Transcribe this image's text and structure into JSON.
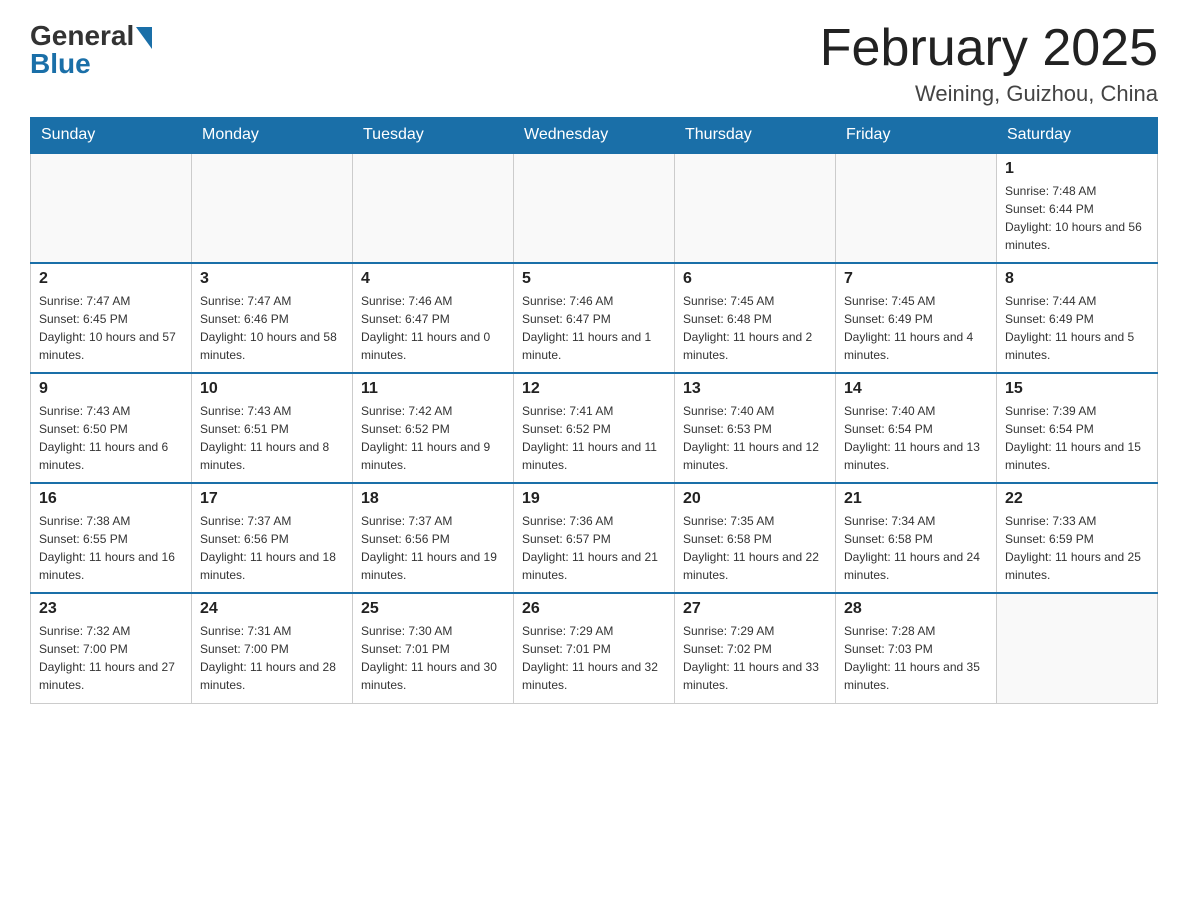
{
  "header": {
    "logo_general": "General",
    "logo_blue": "Blue",
    "month_title": "February 2025",
    "location": "Weining, Guizhou, China"
  },
  "weekdays": [
    "Sunday",
    "Monday",
    "Tuesday",
    "Wednesday",
    "Thursday",
    "Friday",
    "Saturday"
  ],
  "weeks": [
    [
      {
        "day": "",
        "sunrise": "",
        "sunset": "",
        "daylight": ""
      },
      {
        "day": "",
        "sunrise": "",
        "sunset": "",
        "daylight": ""
      },
      {
        "day": "",
        "sunrise": "",
        "sunset": "",
        "daylight": ""
      },
      {
        "day": "",
        "sunrise": "",
        "sunset": "",
        "daylight": ""
      },
      {
        "day": "",
        "sunrise": "",
        "sunset": "",
        "daylight": ""
      },
      {
        "day": "",
        "sunrise": "",
        "sunset": "",
        "daylight": ""
      },
      {
        "day": "1",
        "sunrise": "Sunrise: 7:48 AM",
        "sunset": "Sunset: 6:44 PM",
        "daylight": "Daylight: 10 hours and 56 minutes."
      }
    ],
    [
      {
        "day": "2",
        "sunrise": "Sunrise: 7:47 AM",
        "sunset": "Sunset: 6:45 PM",
        "daylight": "Daylight: 10 hours and 57 minutes."
      },
      {
        "day": "3",
        "sunrise": "Sunrise: 7:47 AM",
        "sunset": "Sunset: 6:46 PM",
        "daylight": "Daylight: 10 hours and 58 minutes."
      },
      {
        "day": "4",
        "sunrise": "Sunrise: 7:46 AM",
        "sunset": "Sunset: 6:47 PM",
        "daylight": "Daylight: 11 hours and 0 minutes."
      },
      {
        "day": "5",
        "sunrise": "Sunrise: 7:46 AM",
        "sunset": "Sunset: 6:47 PM",
        "daylight": "Daylight: 11 hours and 1 minute."
      },
      {
        "day": "6",
        "sunrise": "Sunrise: 7:45 AM",
        "sunset": "Sunset: 6:48 PM",
        "daylight": "Daylight: 11 hours and 2 minutes."
      },
      {
        "day": "7",
        "sunrise": "Sunrise: 7:45 AM",
        "sunset": "Sunset: 6:49 PM",
        "daylight": "Daylight: 11 hours and 4 minutes."
      },
      {
        "day": "8",
        "sunrise": "Sunrise: 7:44 AM",
        "sunset": "Sunset: 6:49 PM",
        "daylight": "Daylight: 11 hours and 5 minutes."
      }
    ],
    [
      {
        "day": "9",
        "sunrise": "Sunrise: 7:43 AM",
        "sunset": "Sunset: 6:50 PM",
        "daylight": "Daylight: 11 hours and 6 minutes."
      },
      {
        "day": "10",
        "sunrise": "Sunrise: 7:43 AM",
        "sunset": "Sunset: 6:51 PM",
        "daylight": "Daylight: 11 hours and 8 minutes."
      },
      {
        "day": "11",
        "sunrise": "Sunrise: 7:42 AM",
        "sunset": "Sunset: 6:52 PM",
        "daylight": "Daylight: 11 hours and 9 minutes."
      },
      {
        "day": "12",
        "sunrise": "Sunrise: 7:41 AM",
        "sunset": "Sunset: 6:52 PM",
        "daylight": "Daylight: 11 hours and 11 minutes."
      },
      {
        "day": "13",
        "sunrise": "Sunrise: 7:40 AM",
        "sunset": "Sunset: 6:53 PM",
        "daylight": "Daylight: 11 hours and 12 minutes."
      },
      {
        "day": "14",
        "sunrise": "Sunrise: 7:40 AM",
        "sunset": "Sunset: 6:54 PM",
        "daylight": "Daylight: 11 hours and 13 minutes."
      },
      {
        "day": "15",
        "sunrise": "Sunrise: 7:39 AM",
        "sunset": "Sunset: 6:54 PM",
        "daylight": "Daylight: 11 hours and 15 minutes."
      }
    ],
    [
      {
        "day": "16",
        "sunrise": "Sunrise: 7:38 AM",
        "sunset": "Sunset: 6:55 PM",
        "daylight": "Daylight: 11 hours and 16 minutes."
      },
      {
        "day": "17",
        "sunrise": "Sunrise: 7:37 AM",
        "sunset": "Sunset: 6:56 PM",
        "daylight": "Daylight: 11 hours and 18 minutes."
      },
      {
        "day": "18",
        "sunrise": "Sunrise: 7:37 AM",
        "sunset": "Sunset: 6:56 PM",
        "daylight": "Daylight: 11 hours and 19 minutes."
      },
      {
        "day": "19",
        "sunrise": "Sunrise: 7:36 AM",
        "sunset": "Sunset: 6:57 PM",
        "daylight": "Daylight: 11 hours and 21 minutes."
      },
      {
        "day": "20",
        "sunrise": "Sunrise: 7:35 AM",
        "sunset": "Sunset: 6:58 PM",
        "daylight": "Daylight: 11 hours and 22 minutes."
      },
      {
        "day": "21",
        "sunrise": "Sunrise: 7:34 AM",
        "sunset": "Sunset: 6:58 PM",
        "daylight": "Daylight: 11 hours and 24 minutes."
      },
      {
        "day": "22",
        "sunrise": "Sunrise: 7:33 AM",
        "sunset": "Sunset: 6:59 PM",
        "daylight": "Daylight: 11 hours and 25 minutes."
      }
    ],
    [
      {
        "day": "23",
        "sunrise": "Sunrise: 7:32 AM",
        "sunset": "Sunset: 7:00 PM",
        "daylight": "Daylight: 11 hours and 27 minutes."
      },
      {
        "day": "24",
        "sunrise": "Sunrise: 7:31 AM",
        "sunset": "Sunset: 7:00 PM",
        "daylight": "Daylight: 11 hours and 28 minutes."
      },
      {
        "day": "25",
        "sunrise": "Sunrise: 7:30 AM",
        "sunset": "Sunset: 7:01 PM",
        "daylight": "Daylight: 11 hours and 30 minutes."
      },
      {
        "day": "26",
        "sunrise": "Sunrise: 7:29 AM",
        "sunset": "Sunset: 7:01 PM",
        "daylight": "Daylight: 11 hours and 32 minutes."
      },
      {
        "day": "27",
        "sunrise": "Sunrise: 7:29 AM",
        "sunset": "Sunset: 7:02 PM",
        "daylight": "Daylight: 11 hours and 33 minutes."
      },
      {
        "day": "28",
        "sunrise": "Sunrise: 7:28 AM",
        "sunset": "Sunset: 7:03 PM",
        "daylight": "Daylight: 11 hours and 35 minutes."
      },
      {
        "day": "",
        "sunrise": "",
        "sunset": "",
        "daylight": ""
      }
    ]
  ]
}
